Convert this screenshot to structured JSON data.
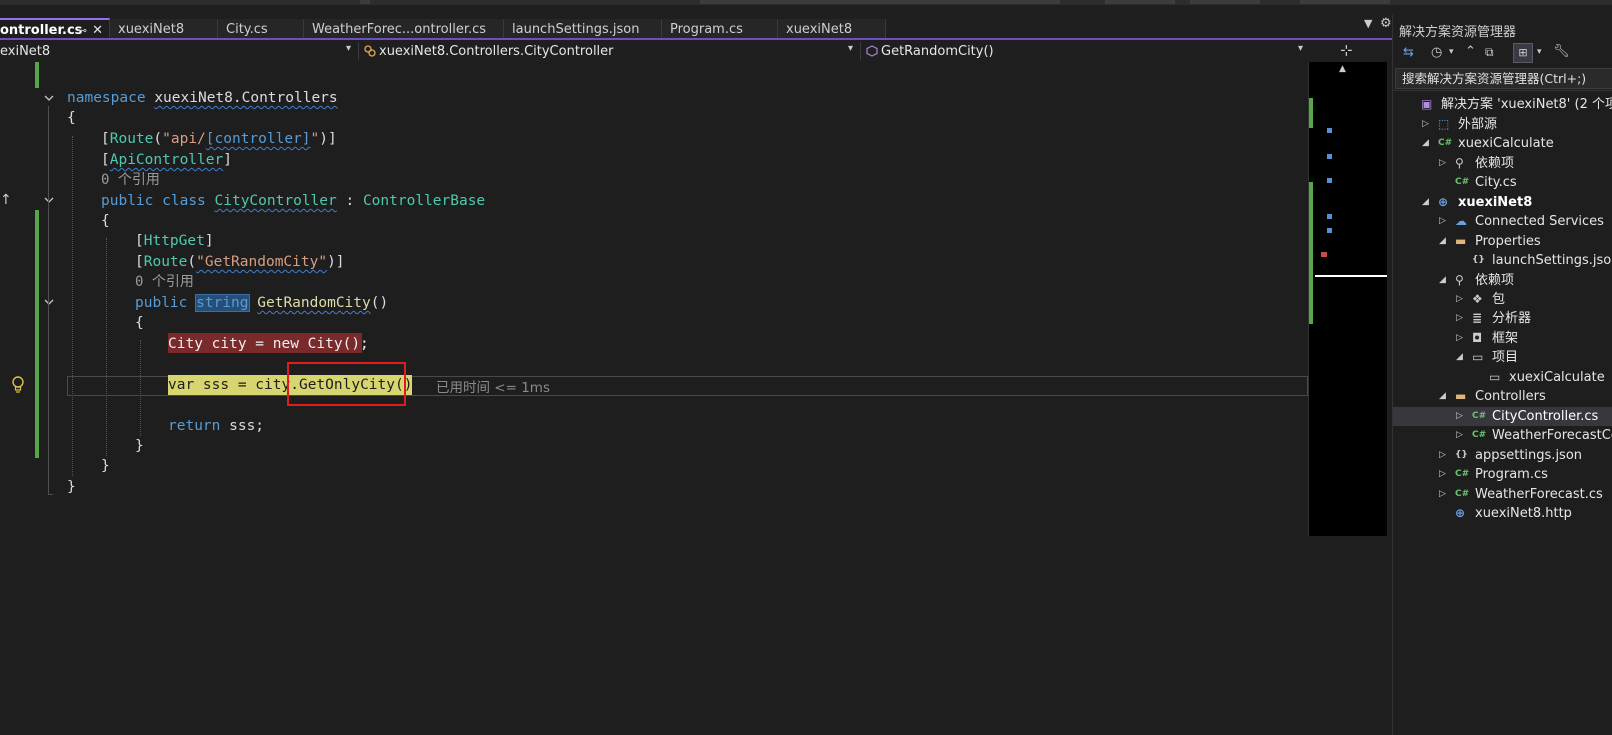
{
  "tabs": [
    {
      "label": "ontroller.cs",
      "active": true,
      "pin": "⊸",
      "close": "✕"
    },
    {
      "label": "xuexiNet8"
    },
    {
      "label": "City.cs"
    },
    {
      "label": "WeatherForec...ontroller.cs"
    },
    {
      "label": "launchSettings.json"
    },
    {
      "label": "Program.cs"
    },
    {
      "label": "xuexiNet8"
    }
  ],
  "nav": {
    "project": "exiNet8",
    "class": "xuexiNet8.Controllers.CityController",
    "member": "GetRandomCity()"
  },
  "code": {
    "ns_kw": "namespace",
    "ns_name": "xuexiNet8.Controllers",
    "brace_open": "{",
    "brace_close": "}",
    "route_attr": "Route",
    "route_str1": "\"api/",
    "route_ctrl": "[controller]",
    "route_str2": "\"",
    "apicontroller": "ApiController",
    "refs": "0 个引用",
    "public": "public",
    "class_kw": "class",
    "class_name": "CityController",
    "colon": " : ",
    "base": "ControllerBase",
    "httpget": "HttpGet",
    "route2_str": "\"GetRandomCity\"",
    "string_kw": "string",
    "method": "GetRandomCity",
    "parens": "()",
    "line_city": "City city = new City();",
    "var_kw": "var",
    "sss": " sss = city.",
    "getonly": "GetOnlyCity",
    "call_end": "();",
    "elapsed": "已用时间 <= 1ms",
    "return_kw": "return",
    "return_rest": " sss;"
  },
  "solution_explorer": {
    "title": "解决方案资源管理器",
    "search": "搜索解决方案资源管理器(Ctrl+;)",
    "nodes": [
      {
        "label": "解决方案 'xuexiNet8' (2 个项目",
        "icon": "solution-icon"
      },
      {
        "label": "外部源",
        "icon": "external-icon"
      },
      {
        "label": "xuexiCalculate",
        "icon": "csharp-project-icon"
      },
      {
        "label": "依赖项",
        "icon": "dependencies-icon"
      },
      {
        "label": "City.cs",
        "icon": "csharp-file-icon",
        "badge": "C#"
      },
      {
        "label": "xuexiNet8",
        "icon": "web-project-icon"
      },
      {
        "label": "Connected Services",
        "icon": "connected-services-icon"
      },
      {
        "label": "Properties",
        "icon": "folder-icon"
      },
      {
        "label": "launchSettings.json",
        "icon": "json-icon"
      },
      {
        "label": "依赖项",
        "icon": "dependencies-icon"
      },
      {
        "label": "包",
        "icon": "package-icon"
      },
      {
        "label": "分析器",
        "icon": "analyzer-icon"
      },
      {
        "label": "框架",
        "icon": "framework-icon"
      },
      {
        "label": "项目",
        "icon": "project-ref-icon"
      },
      {
        "label": "xuexiCalculate",
        "icon": "project-ref-icon"
      },
      {
        "label": "Controllers",
        "icon": "folder-icon"
      },
      {
        "label": "CityController.cs",
        "icon": "csharp-file-icon",
        "badge": "C#"
      },
      {
        "label": "WeatherForecastController.cs",
        "icon": "csharp-file-icon",
        "badge": "C#"
      },
      {
        "label": "appsettings.json",
        "icon": "json-icon"
      },
      {
        "label": "Program.cs",
        "icon": "csharp-file-icon",
        "badge": "C#"
      },
      {
        "label": "WeatherForecast.cs",
        "icon": "csharp-file-icon",
        "badge": "C#"
      },
      {
        "label": "xuexiNet8.http",
        "icon": "http-file-icon"
      }
    ]
  },
  "colors": {
    "accent": "#9a6cf0",
    "keyword": "#569cd6",
    "type": "#4ec9b0",
    "method": "#dcdcaa",
    "string": "#d69d85",
    "breakpoint_line": "#7a2a2a",
    "current_line": "#d7d56f",
    "annotation_box": "#e01b1b",
    "change_bar": "#57a64a"
  }
}
